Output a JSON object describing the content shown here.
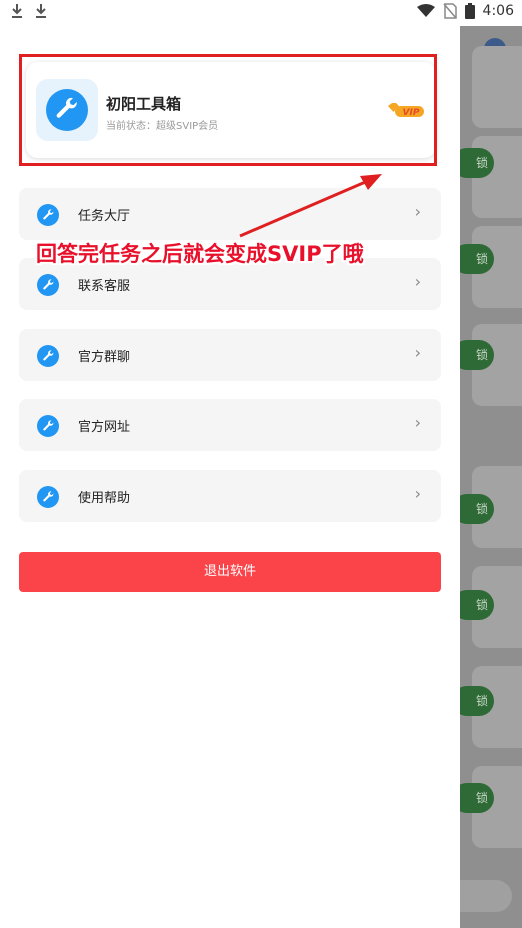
{
  "status_bar": {
    "time": "4:06",
    "left_icons": [
      "download-icon",
      "download-icon"
    ],
    "right_icons": [
      "wifi-icon",
      "no-sim-icon",
      "battery-icon"
    ]
  },
  "profile": {
    "app_name": "初阳工具箱",
    "status_text": "当前状态：超级SVIP会员",
    "vip_badge": "VIP"
  },
  "menu": {
    "items": [
      {
        "label": "任务大厅",
        "icon": "wrench-icon"
      },
      {
        "label": "联系客服",
        "icon": "wrench-icon"
      },
      {
        "label": "官方群聊",
        "icon": "wrench-icon"
      },
      {
        "label": "官方网址",
        "icon": "wrench-icon"
      },
      {
        "label": "使用帮助",
        "icon": "wrench-icon"
      }
    ],
    "chevron": "›"
  },
  "logout": {
    "label": "退出软件"
  },
  "annotation": {
    "text": "回答完任务之后就会变成SVIP了哦"
  },
  "background_app": {
    "button_text": [
      "锁",
      "锁",
      "锁",
      "锁",
      "锁",
      "锁",
      "锁"
    ]
  },
  "colors": {
    "accent": "#2196f3",
    "logout": "#fb444a",
    "annotation": "#e02020",
    "vip": "#f5a623"
  }
}
